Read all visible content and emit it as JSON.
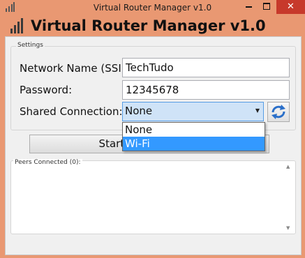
{
  "window": {
    "title": "Virtual Router Manager v1.0",
    "close_glyph": "✕"
  },
  "header": {
    "title": "Virtual Router Manager v1.0"
  },
  "settings": {
    "group_label": "Settings",
    "ssid_label": "Network Name (SSID):",
    "ssid_value": "TechTudo",
    "password_label": "Password:",
    "password_value": "12345678",
    "shared_label": "Shared Connection:",
    "shared_selected": "None",
    "dropdown_arrow": "▼",
    "options": [
      "None",
      "Wi-Fi"
    ],
    "highlighted_option": "Wi-Fi"
  },
  "start_button_label": "Start Virtual Router",
  "peers": {
    "group_label": "Peers Connected (0):",
    "scroll_up": "▲",
    "scroll_down": "▼"
  },
  "colors": {
    "window_frame": "#e99872",
    "close_button": "#c7392b",
    "selection": "#3399ff",
    "combo_focus": "#cfe3f7"
  },
  "icons": {
    "app": "antenna-icon",
    "refresh": "refresh-icon"
  }
}
